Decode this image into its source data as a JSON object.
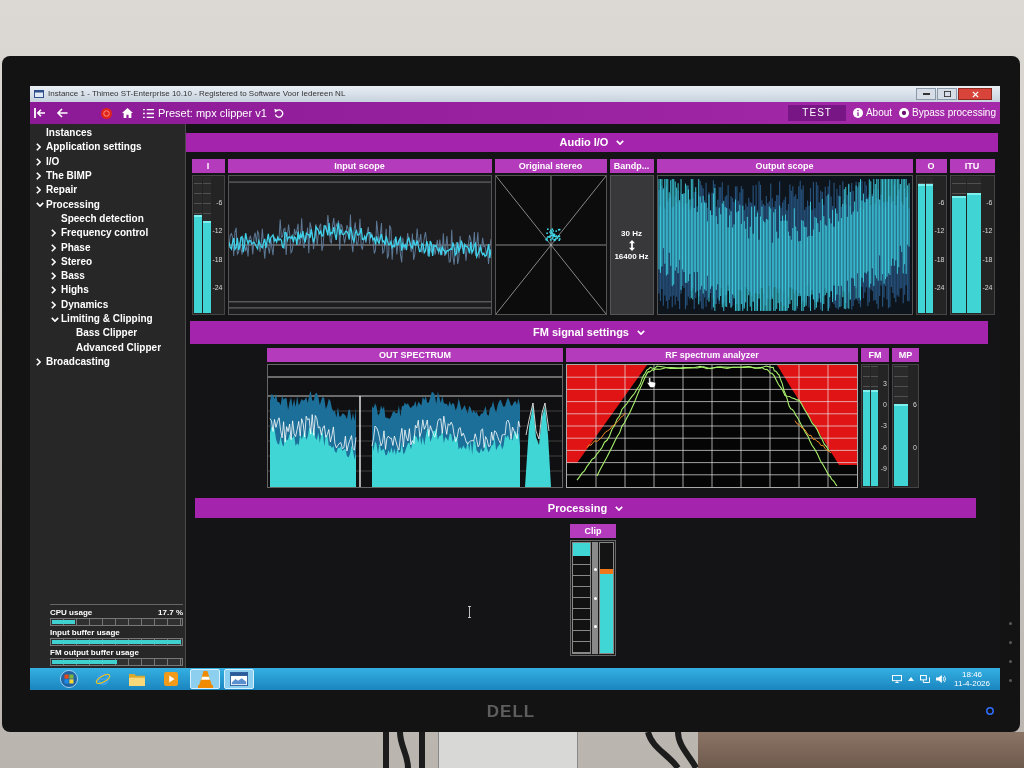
{
  "monitor": {
    "brand": "DELL"
  },
  "title_bar": {
    "title": "Instance 1 - Thimeo ST-Enterprise 10.10 - Registered to Software Voor Iedereen NL"
  },
  "toolbar": {
    "preset": "Preset: mpx clipper v1",
    "test": "TEST",
    "about": "About",
    "bypass": "Bypass processing"
  },
  "sidebar": {
    "tree": [
      {
        "label": "Instances",
        "kind": "leaf"
      },
      {
        "label": "Application settings",
        "kind": "group",
        "expanded": false
      },
      {
        "label": "I/O",
        "kind": "group",
        "expanded": false
      },
      {
        "label": "The BIMP",
        "kind": "group",
        "expanded": false
      },
      {
        "label": "Repair",
        "kind": "group",
        "expanded": false
      },
      {
        "label": "Processing",
        "kind": "group",
        "expanded": true,
        "children": [
          {
            "label": "Speech detection",
            "kind": "leaf"
          },
          {
            "label": "Frequency control",
            "kind": "group",
            "expanded": false
          },
          {
            "label": "Phase",
            "kind": "group",
            "expanded": false
          },
          {
            "label": "Stereo",
            "kind": "group",
            "expanded": false
          },
          {
            "label": "Bass",
            "kind": "group",
            "expanded": false
          },
          {
            "label": "Highs",
            "kind": "group",
            "expanded": false
          },
          {
            "label": "Dynamics",
            "kind": "group",
            "expanded": false
          },
          {
            "label": "Limiting & Clipping",
            "kind": "group",
            "expanded": true,
            "children": [
              {
                "label": "Bass Clipper",
                "kind": "leaf"
              },
              {
                "label": "Advanced Clipper",
                "kind": "leaf"
              }
            ]
          }
        ]
      },
      {
        "label": "Broadcasting",
        "kind": "group",
        "expanded": false
      }
    ],
    "usage": [
      {
        "label": "CPU usage",
        "reading": "17.7 %",
        "level": 0.18
      },
      {
        "label": "Input buffer usage",
        "level": 1
      },
      {
        "label": "FM output buffer usage",
        "level": 0.5
      }
    ]
  },
  "sections": [
    {
      "title": "Audio I/O",
      "expanded": true,
      "panels": [
        {
          "kind": "meter",
          "title": "I",
          "ticks": [
            "-6",
            "-12",
            "-18",
            "-24"
          ],
          "channels": [
            {
              "level": 0.72
            },
            {
              "level": 0.68
            }
          ]
        },
        {
          "kind": "scope",
          "title": "Input scope",
          "dense": false
        },
        {
          "kind": "goniometer",
          "title": "Original stereo"
        },
        {
          "kind": "filter",
          "title": "Bandp...",
          "low": "30 Hz",
          "high": "16400 Hz"
        },
        {
          "kind": "scope",
          "title": "Output scope",
          "dense": true
        },
        {
          "kind": "meter",
          "title": "O",
          "ticks": [
            "-6",
            "-12",
            "-18",
            "-24"
          ],
          "channels": [
            {
              "level": 0.95
            },
            {
              "level": 0.95
            }
          ]
        },
        {
          "kind": "meter",
          "title": "ITU",
          "ticks": [
            "-6",
            "-12",
            "-18",
            "-24"
          ],
          "channels": [
            {
              "level": 0.86
            },
            {
              "level": 0.88
            }
          ]
        }
      ]
    },
    {
      "title": "FM signal settings",
      "expanded": true,
      "panels": [
        {
          "kind": "spectrum",
          "title": "OUT SPECTRUM"
        },
        {
          "kind": "analyzer",
          "title": "RF spectrum analyzer"
        },
        {
          "kind": "meter",
          "title": "FM",
          "ticks": [
            "3",
            "0",
            "-3",
            "-6",
            "-9"
          ],
          "channels": [
            {
              "level": 0.8
            },
            {
              "level": 0.8
            }
          ]
        },
        {
          "kind": "meter",
          "title": "MP",
          "ticks": [
            "6",
            "0"
          ],
          "channels": [
            {
              "level": 0.68
            }
          ]
        }
      ]
    },
    {
      "title": "Processing",
      "expanded": true,
      "panels": [
        {
          "kind": "clip",
          "title": "Clip",
          "reduction": {
            "level": 0.12
          },
          "output": {
            "level": 0.72
          }
        }
      ]
    }
  ],
  "taskbar": {
    "apps": [
      {
        "kind": "start",
        "running": false
      },
      {
        "kind": "browser",
        "running": false
      },
      {
        "kind": "folder",
        "running": false
      },
      {
        "kind": "player",
        "running": false
      },
      {
        "kind": "cone",
        "running": true
      },
      {
        "kind": "window",
        "running": true
      }
    ],
    "time": "18:46",
    "date": "11-4-2026"
  }
}
